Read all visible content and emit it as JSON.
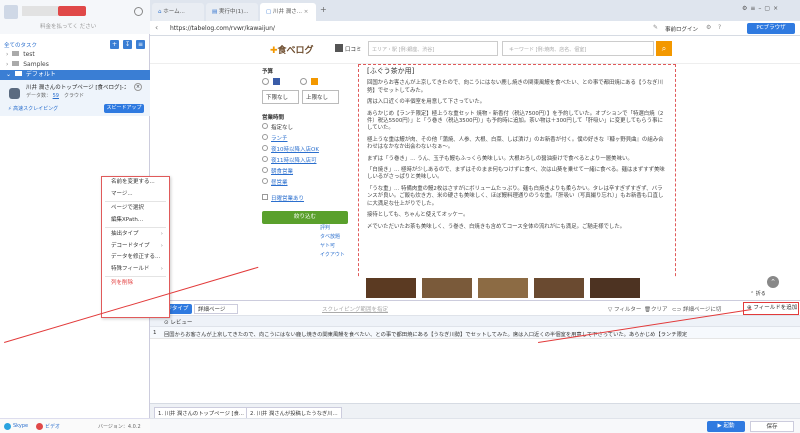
{
  "sidebar": {
    "plan_label": "料金を払ってく ださい",
    "all_tasks": "全てのタスク",
    "trash_label": "test",
    "samples_label": "Samples",
    "default_label": "デフォルト",
    "task": {
      "title": "川井 潤さんのトップページ [食べログ]-ス...",
      "data_label": "データ数：",
      "data_count": "59",
      "cloud_label": "クラウド",
      "mode": "高速スクレイピング",
      "speedup": "スピードアップ"
    },
    "footer": {
      "skype": "Skype",
      "video": "ビデオ",
      "version": "バージョン：4.0.2"
    }
  },
  "tabs": [
    {
      "label": "ホーム..."
    },
    {
      "label": "実行中(1)..."
    },
    {
      "label": "川井 潤さ..."
    }
  ],
  "titlebar": {
    "register": "事前ログイン",
    "pc_browser": "PCブラウザ"
  },
  "address": {
    "url": "https://tabelog.com/rvwr/kawaijun/"
  },
  "tabelog": {
    "logo": "食べログ",
    "area_label": "口コミ",
    "area_placeholder": "エリア・駅 [例:銀座、渋谷]",
    "keyword_placeholder": "キーワード [例:焼肉、店名、個室]"
  },
  "left_panel": {
    "yosan": "予算",
    "select1": "下限なし",
    "select2": "上限なし",
    "hours_title": "営業時間",
    "radios": [
      "指定なし",
      "ランチ",
      "夜10時以降入店OK",
      "夜11時以降入店可",
      "朝食営業",
      "昼営業"
    ],
    "check": "日曜営業あり",
    "search_btn": "絞り込む"
  },
  "article": {
    "heading": "[ふぐう茶か用]",
    "paragraphs": [
      "回国からお客さんが上京してきたので、向こうにはない鹿し焼きの関東風鰻を食べたい、との事で都田焼にある【うなぎ川勢】でセットしてみた。",
      "席は入口近くの半個室を用意して下さっていた。",
      "あらかじめ【ランチ限定】極上うな重セット 焼物・新香付（税込7500円）】を予約していた。オプションで「特選白焼（2件）税込5500円）」と「う巻き（税込3500円）」も予約時に追加。茶い物は＋300円して「肝吸い」に変更してもらう事にしていた。",
      "極上うな重は鰻が肉、その他「蒲焼、人参、大根、白菜、しば漬け」のお新香が付く。僕の好きな『糠ヶ野貝曲』の組み合わせはなかなか出会わないなぁ〜。",
      "まずは「う巻き」… うん、玉子も鰻もふっくら美味しい。大根おろしの醤油掛けで食べるとより一層美味い。",
      "「白焼き」… 極時が少しあるので、まずはそのまま何もつけずに食べ、次は山葵を乗せて一緒に食べる。麺はまずすず美味しいるがさっぱりと美味しい。",
      "「うな重」… 特備肉重の鰻2枚はさすがにボリュームたっぷり。麺も白焼きよりも柔らかい。タレは辛すぎずすぎず、バランスが良い。ご飯も炊き方、米の硬さも美味しく、ほぼ鰻料理通りのうな重。「肝吸い（写真撮り忘れ）」もお新香も口直しに大満足な仕上がりでした。",
      "接待としても、ちゃんと使えてオッケー。",
      "〆でいただいたお茶も美味しく、う巻き、白焼きも含めてコース全体の流れがにも満足。ご馳走様でした。"
    ]
  },
  "context_menu": {
    "items": [
      {
        "label": "名前を変更する...",
        "sub": false
      },
      {
        "label": "マージ...",
        "sub": false
      },
      {
        "label": "ページで選択",
        "sub": false
      },
      {
        "label": "編集XPath...",
        "sub": false
      },
      {
        "label": "抽出タイプ",
        "sub": true
      },
      {
        "label": "デコードタイプ",
        "sub": true
      },
      {
        "label": "データを修正する...",
        "sub": false
      },
      {
        "label": "特殊フィールド",
        "sub": true
      },
      {
        "label": "列を削除",
        "sub": false
      }
    ]
  },
  "peek_links": [
    "評判",
    "タベ放題",
    "ヤト可",
    "イクアウト"
  ],
  "pane": {
    "page_type_label": "ページタイプ",
    "page_type_value": "詳細ページ",
    "scrape_link": "スクレイピング範囲を指定",
    "filter": "フィルター",
    "clear": "クリア",
    "detail_page": "詳細ページに切",
    "add_field": "フィールドを追加",
    "col_header": "レビュー",
    "row_num": "1",
    "row_text": "回国からお客さんが上京してきたので、向こうにはない鹿し焼きの関東風鰻を食べたい、との事で都田焼にある【うなぎ川勢】でセットしてみた。席は入口近くの半個室を用意して下さっていた。あらかじめ【ランチ限定"
  },
  "bottom": {
    "tab1": "1. 川井 潤さんのトップページ [食...",
    "tab2": "2. 川井 潤さんが投稿したうなぎ川...",
    "start": "起動",
    "save": "保存",
    "fold": "折る"
  },
  "colors": {
    "accent": "#2f7ae0",
    "annotation": "#e23a3a",
    "tabelog_orange": "#f39800"
  }
}
